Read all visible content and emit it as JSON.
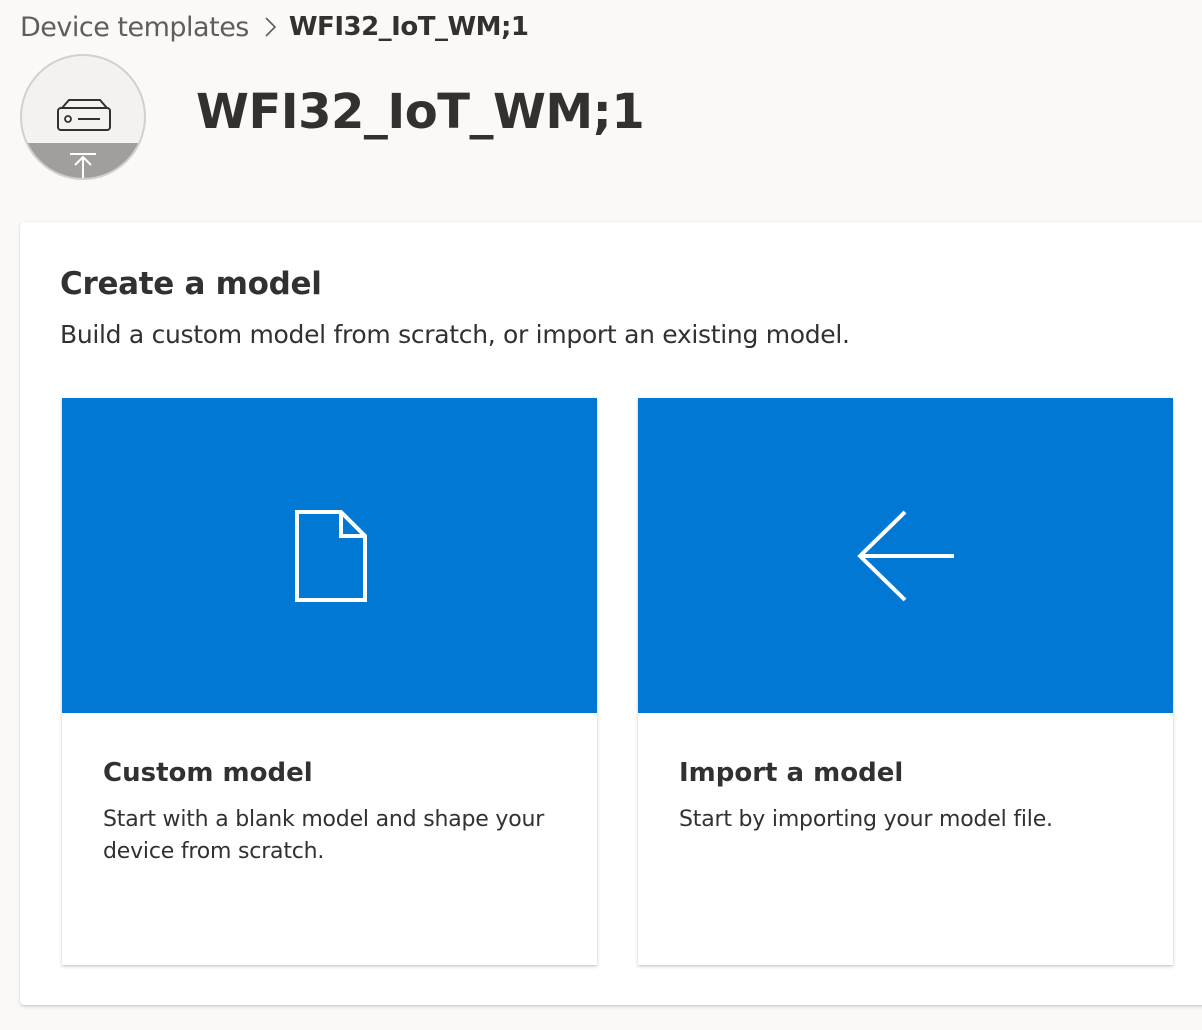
{
  "breadcrumb": {
    "parent": "Device templates",
    "current": "WFI32_IoT_WM;1"
  },
  "header": {
    "title": "WFI32_IoT_WM;1",
    "avatar_icon": "device-upload-icon"
  },
  "panel": {
    "title": "Create a model",
    "subtitle": "Build a custom model from scratch, or import an existing model."
  },
  "cards": [
    {
      "icon": "page-icon",
      "title": "Custom model",
      "description": "Start with a blank model and shape your device from scratch."
    },
    {
      "icon": "arrow-left-icon",
      "title": "Import a model",
      "description": "Start by importing your model file."
    }
  ],
  "colors": {
    "accent": "#0078d4",
    "page_background": "#faf9f8",
    "text": "#323130"
  }
}
